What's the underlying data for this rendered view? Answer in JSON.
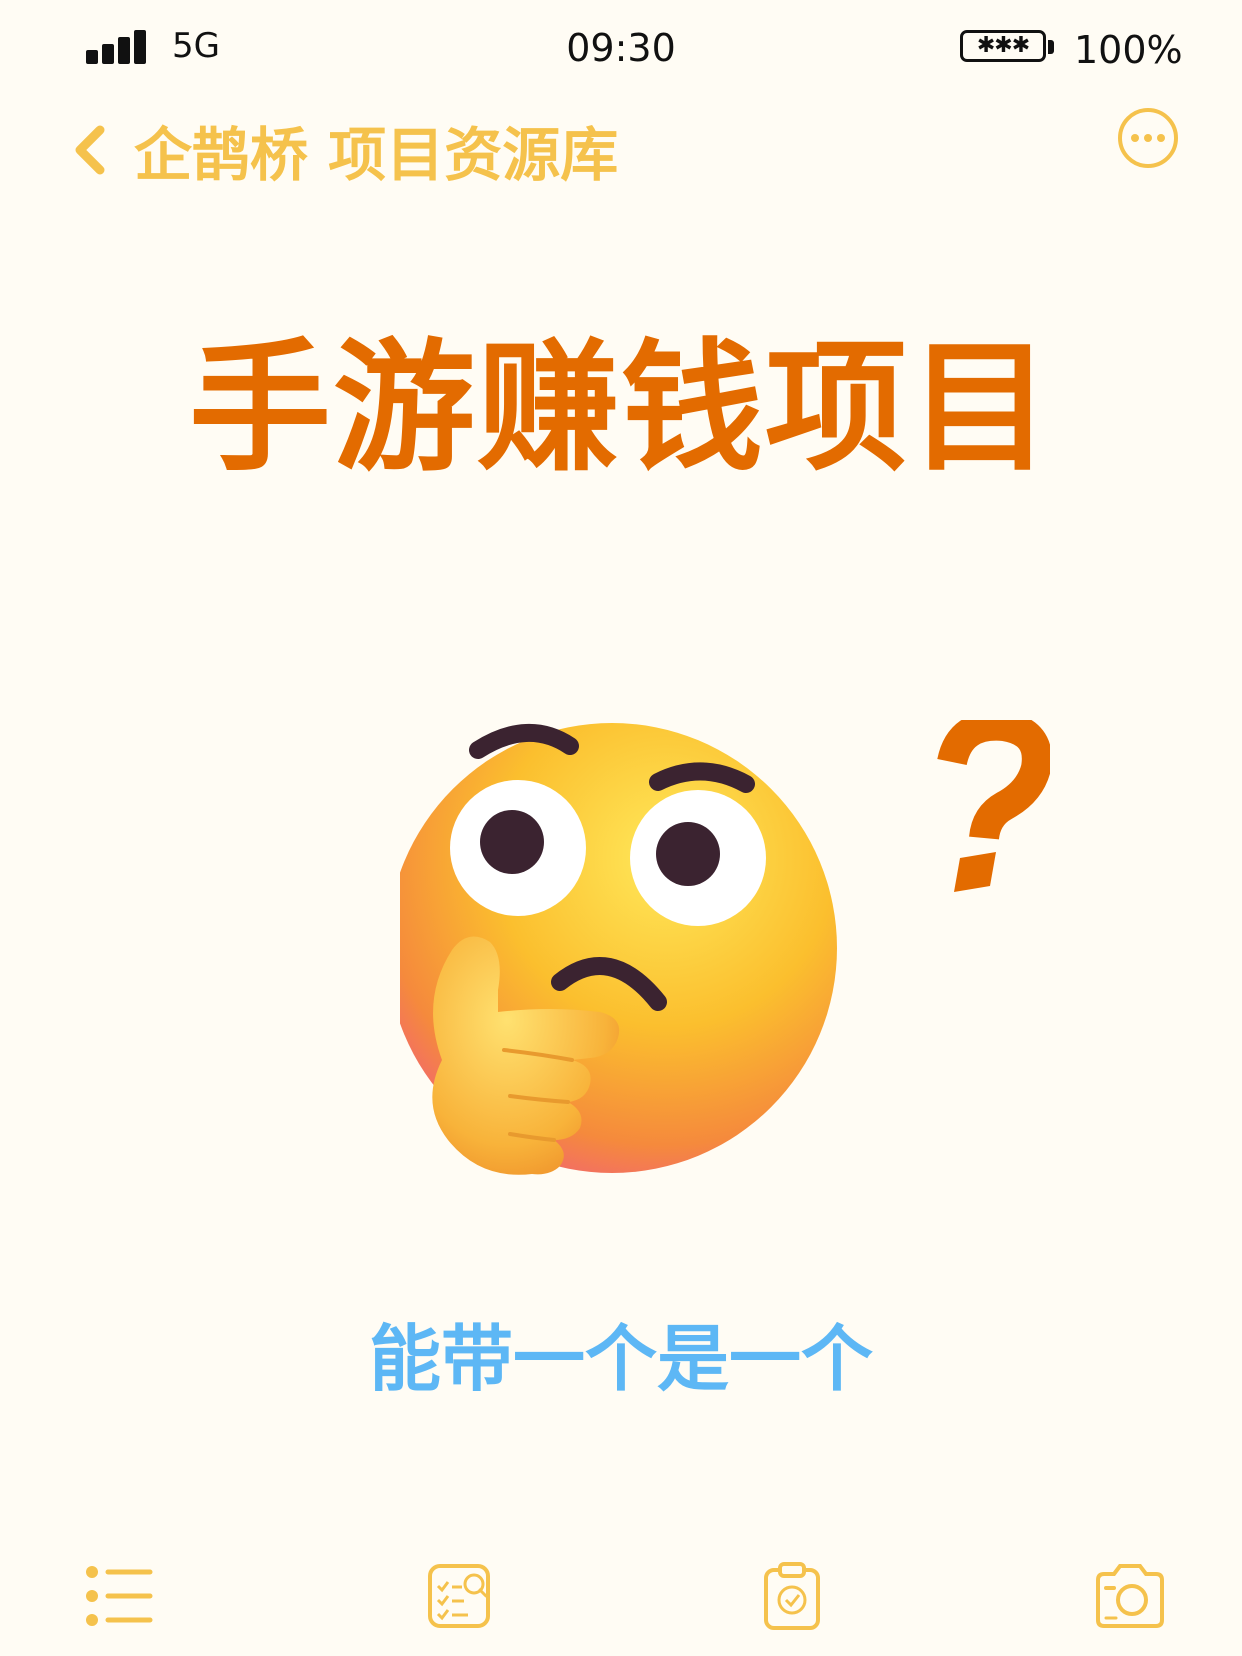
{
  "status_bar": {
    "network": "5G",
    "time": "09:30",
    "battery_label": "✱✱✱",
    "battery_percent": "100%"
  },
  "nav": {
    "title": "企鹊桥 项目资源库",
    "back_icon": "chevron-left-icon",
    "more_icon": "more-circle-icon"
  },
  "main": {
    "headline": "手游赚钱项目",
    "subtitle": "能带一个是一个",
    "emoji": "thinking-face-emoji",
    "question_mark": "?"
  },
  "tab_bar": {
    "items": [
      {
        "icon": "list-icon"
      },
      {
        "icon": "checklist-search-icon"
      },
      {
        "icon": "clipboard-check-icon"
      },
      {
        "icon": "camera-icon"
      }
    ]
  },
  "colors": {
    "background": "#FFFCF4",
    "accent": "#F5C24C",
    "headline": "#E36B00",
    "subtitle": "#5DB7F5"
  }
}
